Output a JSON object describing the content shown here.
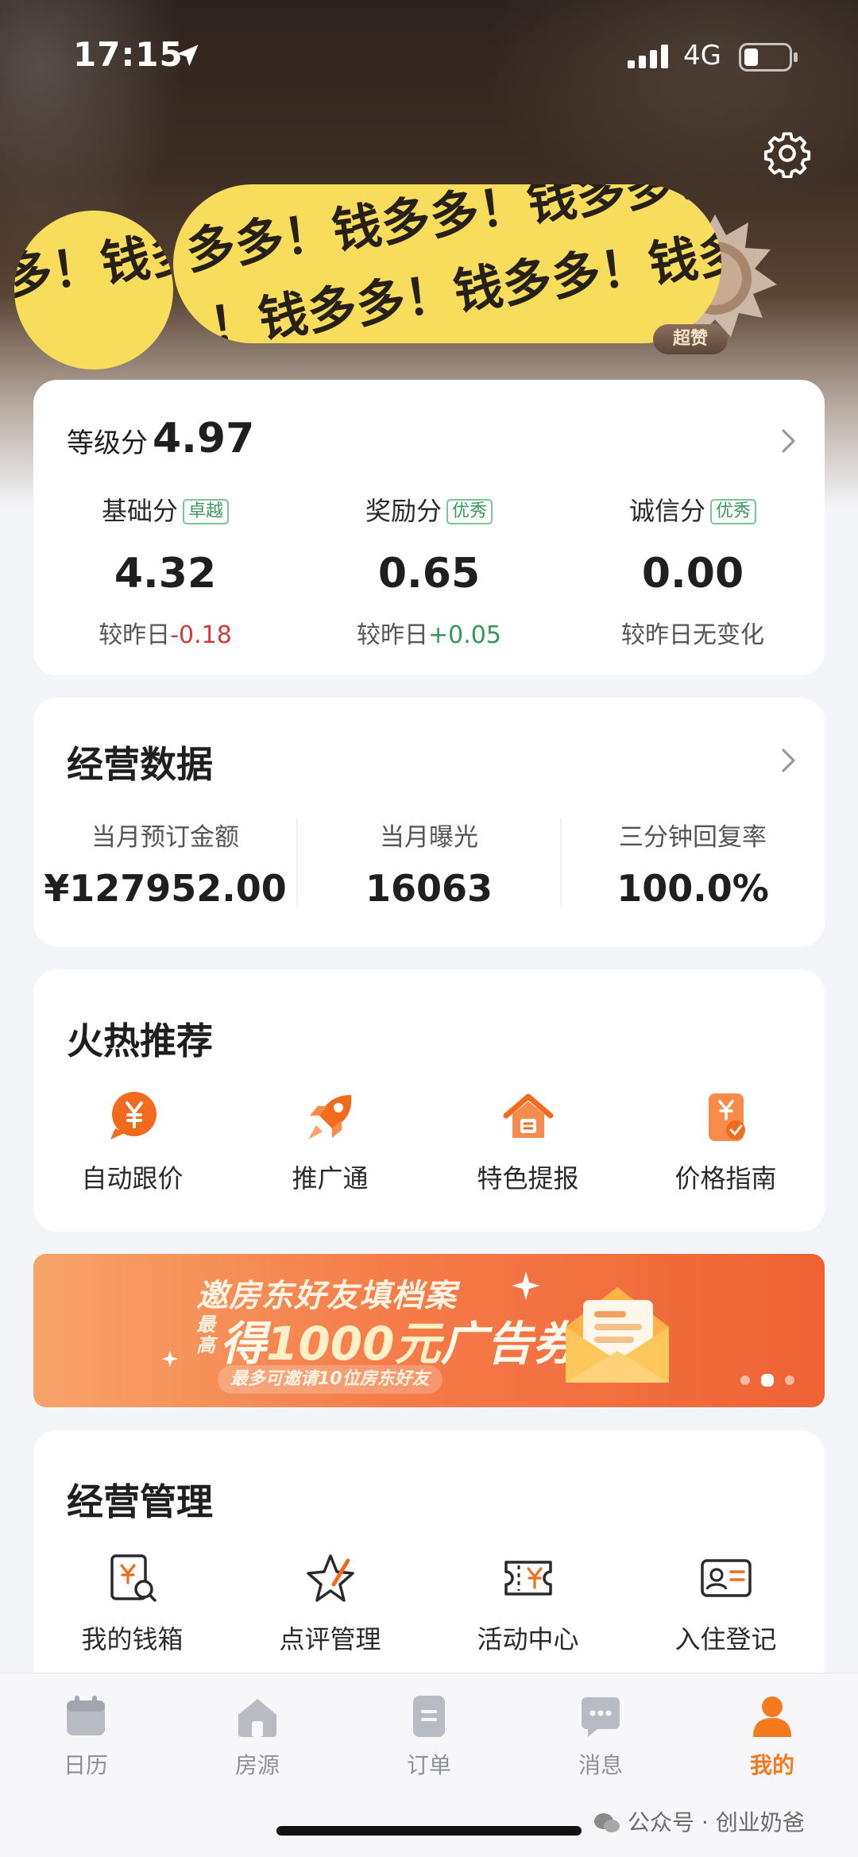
{
  "status_bar": {
    "time": "17:15",
    "network": "4G"
  },
  "profile": {
    "avatar_text": "多！钱多多！钱",
    "name_text_row1": "多多！钱多多！钱多多！钱",
    "name_text_row2": "！钱多多！钱多多！钱多多",
    "badge_label": "超赞"
  },
  "score_card": {
    "title": "等级分",
    "value": "4.97",
    "items": [
      {
        "label": "基础分",
        "tag": "卓越",
        "value": "4.32",
        "diff_prefix": "较昨日",
        "diff": "-0.18",
        "trend": "down"
      },
      {
        "label": "奖励分",
        "tag": "优秀",
        "value": "0.65",
        "diff_prefix": "较昨日",
        "diff": "+0.05",
        "trend": "up"
      },
      {
        "label": "诚信分",
        "tag": "优秀",
        "value": "0.00",
        "diff_prefix": "较昨日",
        "diff": "无变化",
        "trend": "flat"
      }
    ]
  },
  "business_data": {
    "title": "经营数据",
    "metrics": [
      {
        "label": "当月预订金额",
        "value": "¥127952.00"
      },
      {
        "label": "当月曝光",
        "value": "16063"
      },
      {
        "label": "三分钟回复率",
        "value": "100.0%"
      }
    ]
  },
  "hot": {
    "title": "火热推荐",
    "items": [
      {
        "label": "自动跟价",
        "icon": "yen-bubble-icon"
      },
      {
        "label": "推广通",
        "icon": "rocket-icon"
      },
      {
        "label": "特色提报",
        "icon": "house-icon"
      },
      {
        "label": "价格指南",
        "icon": "price-guide-icon"
      }
    ]
  },
  "banner": {
    "line1": "邀房东好友填档案",
    "prefix": "最高",
    "line2_a": "得",
    "line2_b": "1000元",
    "line2_c": "广告券",
    "pill": "最多可邀请10位房东好友",
    "slide_count": 3,
    "active_slide": 1
  },
  "manage": {
    "title": "经营管理",
    "items": [
      {
        "label": "我的钱箱",
        "icon": "wallet-search-icon"
      },
      {
        "label": "点评管理",
        "icon": "star-review-icon"
      },
      {
        "label": "活动中心",
        "icon": "ticket-icon"
      },
      {
        "label": "入住登记",
        "icon": "id-card-icon"
      }
    ]
  },
  "tabs": [
    {
      "label": "日历",
      "icon": "calendar-icon",
      "active": false
    },
    {
      "label": "房源",
      "icon": "home-icon",
      "active": false
    },
    {
      "label": "订单",
      "icon": "order-icon",
      "active": false
    },
    {
      "label": "消息",
      "icon": "message-icon",
      "active": false
    },
    {
      "label": "我的",
      "icon": "user-icon",
      "active": true
    }
  ],
  "watermark": "公众号 · 创业奶爸",
  "colors": {
    "accent": "#f57a1e",
    "up": "#2f9a5a",
    "down": "#d43a3a",
    "tag_green": "#3a9a5c"
  }
}
